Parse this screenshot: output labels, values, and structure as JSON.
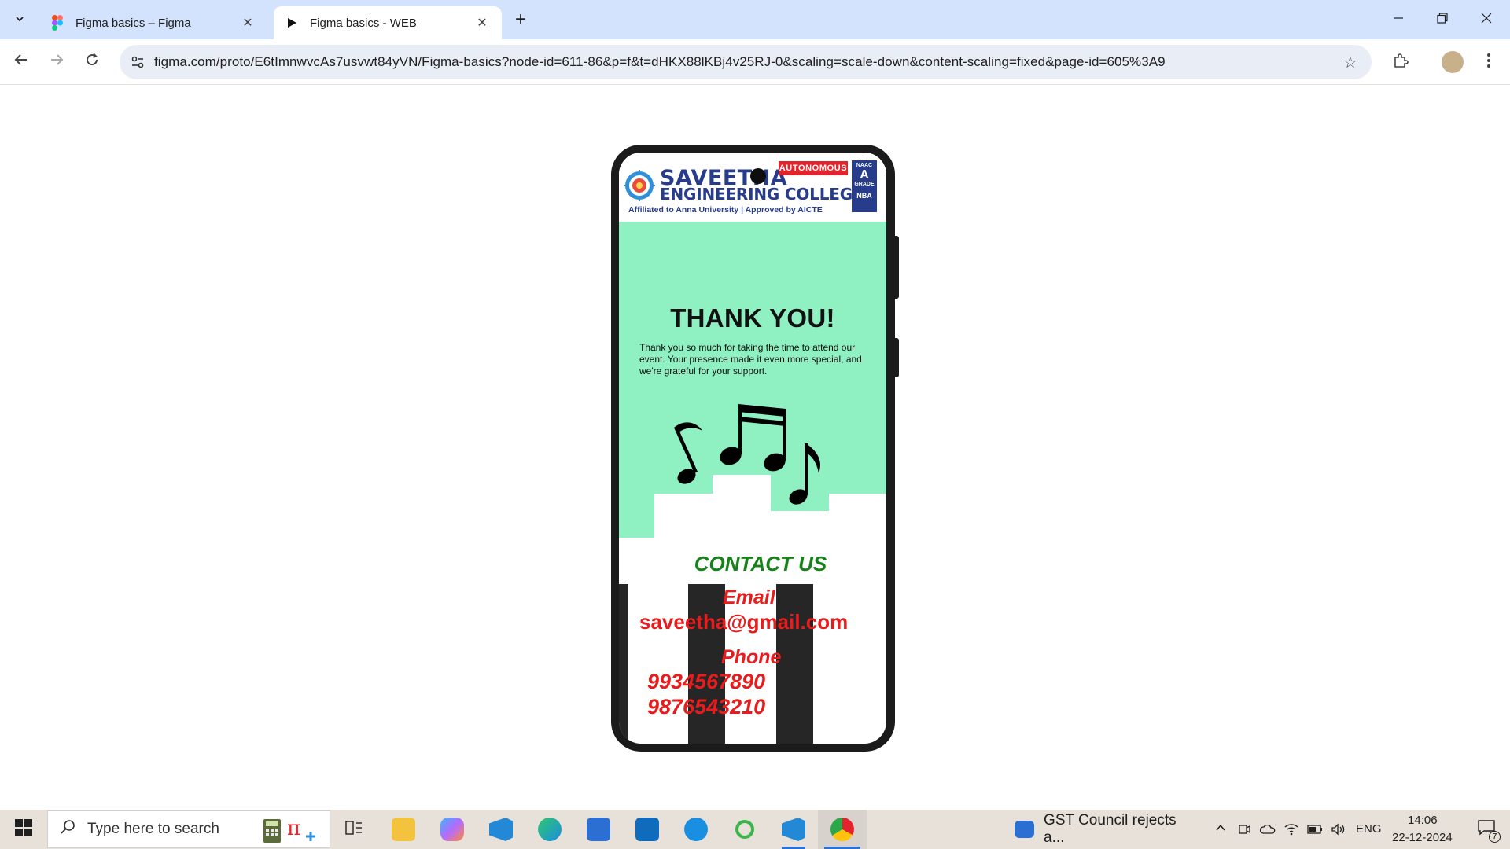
{
  "browser": {
    "tabs": [
      {
        "title": "Figma basics – Figma",
        "active": false
      },
      {
        "title": "Figma basics - WEB",
        "active": true
      }
    ],
    "url": "figma.com/proto/E6tImnwvcAs7usvwt84yVN/Figma-basics?node-id=611-86&p=f&t=dHKX88lKBj4v25RJ-0&scaling=scale-down&content-scaling=fixed&page-id=605%3A9"
  },
  "prototype": {
    "header": {
      "college_line1": "SAVEETHA",
      "college_line2": "ENGINEERING COLLEGE",
      "affiliation": "Affiliated to Anna University | Approved by AICTE",
      "autonomous_badge": "AUTONOMOUS",
      "naac_top": "NAAC",
      "naac_grade": "A",
      "naac_bottom": "GRADE",
      "nba": "NBA"
    },
    "thank_you_title": "THANK YOU!",
    "thank_you_body": "Thank you so much for taking the time to attend our event. Your presence made it even more special, and we're grateful for your support.",
    "contact_title": "CONTACT US",
    "email_label": "Email",
    "email_value": "saveetha@gmail.com",
    "phone_label": "Phone",
    "phone_1": "9934567890",
    "phone_2": "9876543210"
  },
  "taskbar": {
    "search_placeholder": "Type here to search",
    "news_text": "GST Council rejects a...",
    "language": "ENG",
    "time": "14:06",
    "date": "22-12-2024",
    "notification_count": "7"
  },
  "colors": {
    "mint": "#8ff0c2",
    "contact_green": "#178219",
    "contact_red": "#e81c1c",
    "college_blue": "#283c8c",
    "tabstrip": "#d3e3fd"
  }
}
